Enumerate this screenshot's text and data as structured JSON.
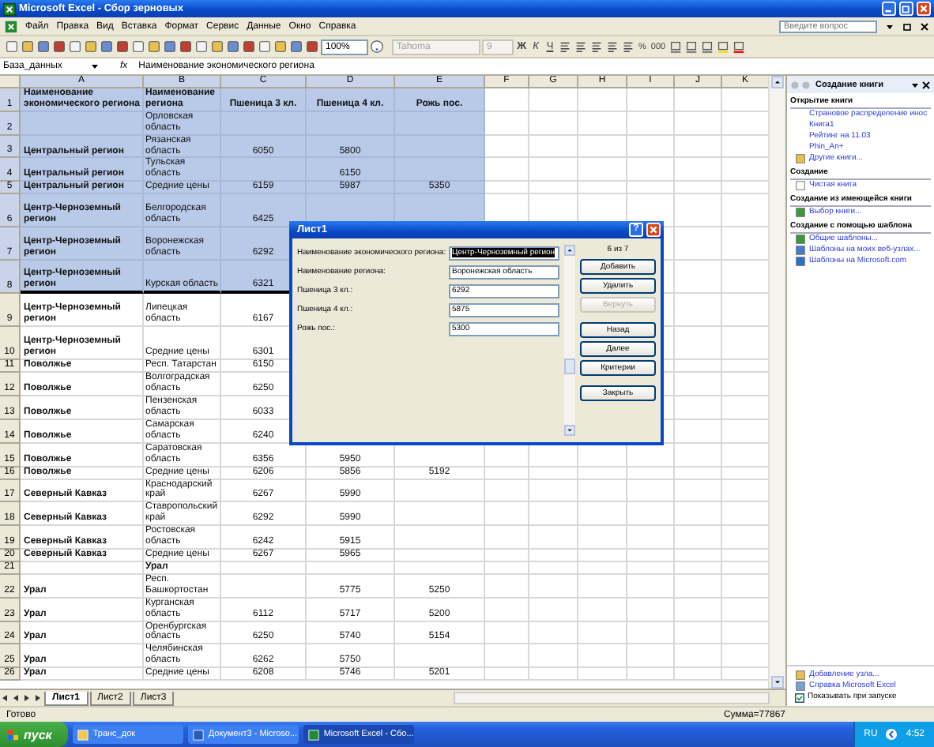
{
  "window": {
    "title": "Microsoft Excel - Сбор зерновых"
  },
  "menu": [
    {
      "label": "Файл"
    },
    {
      "label": "Правка"
    },
    {
      "label": "Вид"
    },
    {
      "label": "Вставка"
    },
    {
      "label": "Формат"
    },
    {
      "label": "Сервис"
    },
    {
      "label": "Данные"
    },
    {
      "label": "Окно"
    },
    {
      "label": "Справка"
    }
  ],
  "help_box": {
    "placeholder": "Введите вопрос"
  },
  "toolbar": {
    "zoom": "100%",
    "font": {
      "value": "Tahoma",
      "disabled": true
    },
    "size": {
      "value": "9",
      "disabled": true
    },
    "format_buttons": [
      "Ж",
      "К",
      "Ч"
    ],
    "number_buttons": [
      "%",
      "000"
    ]
  },
  "formula_bar": {
    "name_box": "База_данных",
    "fx": "fx",
    "content": "Наименование экономического региона"
  },
  "columns": [
    {
      "label": "A",
      "selected": true
    },
    {
      "label": "B",
      "selected": true
    },
    {
      "label": "C",
      "selected": true
    },
    {
      "label": "D",
      "selected": true
    },
    {
      "label": "E",
      "selected": true
    },
    {
      "label": "F",
      "selected": false
    },
    {
      "label": "G",
      "selected": false
    },
    {
      "label": "H",
      "selected": false
    },
    {
      "label": "I",
      "selected": false
    },
    {
      "label": "J",
      "selected": false
    },
    {
      "label": "K",
      "selected": false
    }
  ],
  "rows": [
    {
      "n": "1",
      "kind": "header",
      "selected": true,
      "a": "Наименование экономического региона",
      "b": "Наименование региона",
      "c": "Пшеница 3 кл.",
      "d": "Пшеница 4 кл.",
      "e": "Рожь пос."
    },
    {
      "n": "2",
      "kind": "data",
      "selected": true,
      "b": "Орловская область"
    },
    {
      "n": "3",
      "kind": "data",
      "selected": true,
      "a": "Центральный регион",
      "b": "Рязанская область",
      "c": "6050",
      "d": "5800"
    },
    {
      "n": "4",
      "kind": "data",
      "selected": true,
      "a": "Центральный регион",
      "b": "Тульская область",
      "d": "6150"
    },
    {
      "n": "5",
      "kind": "data",
      "selected": true,
      "a": "Центральный регион",
      "b": "Средние цены",
      "c": "6159",
      "d": "5987",
      "e": "5350"
    },
    {
      "n": "6",
      "kind": "data",
      "selected": true,
      "tall": true,
      "a": "Центр-Черноземный регион",
      "b": "Белгородская область",
      "c": "6425"
    },
    {
      "n": "7",
      "kind": "data",
      "selected": true,
      "tall": true,
      "a": "Центр-Черноземный регион",
      "b": "Воронежская область",
      "c": "6292"
    },
    {
      "n": "8",
      "kind": "data",
      "selected": true,
      "tall": true,
      "a": "Центр-Черноземный регион",
      "b": "Курская область",
      "c": "6321"
    },
    {
      "n": "9",
      "kind": "data",
      "selected": false,
      "tall": true,
      "a": "Центр-Черноземный регион",
      "b": "Липецкая область",
      "c": "6167"
    },
    {
      "n": "10",
      "kind": "data",
      "selected": false,
      "tall": true,
      "a": "Центр-Черноземный регион",
      "b": "Средние цены",
      "c": "6301"
    },
    {
      "n": "11",
      "kind": "data",
      "selected": false,
      "a": "Поволжье",
      "b": "Респ. Татарстан",
      "c": "6150"
    },
    {
      "n": "12",
      "kind": "data",
      "selected": false,
      "a": "Поволжье",
      "b": "Волгоградская область",
      "c": "6250"
    },
    {
      "n": "13",
      "kind": "data",
      "selected": false,
      "a": "Поволжье",
      "b": "Пензенская область",
      "c": "6033"
    },
    {
      "n": "14",
      "kind": "data",
      "selected": false,
      "a": "Поволжье",
      "b": "Самарская область",
      "c": "6240"
    },
    {
      "n": "15",
      "kind": "data",
      "selected": false,
      "a": "Поволжье",
      "b": "Саратовская область",
      "c": "6356",
      "d": "5950"
    },
    {
      "n": "16",
      "kind": "data",
      "selected": false,
      "a": "Поволжье",
      "b": "Средние цены",
      "c": "6206",
      "d": "5856",
      "e": "5192"
    },
    {
      "n": "17",
      "kind": "data",
      "selected": false,
      "a": "Северный Кавказ",
      "b": "Краснодарский край",
      "c": "6267",
      "d": "5990"
    },
    {
      "n": "18",
      "kind": "data",
      "selected": false,
      "a": "Северный Кавказ",
      "b": "Ставропольский край",
      "c": "6292",
      "d": "5990"
    },
    {
      "n": "19",
      "kind": "data",
      "selected": false,
      "a": "Северный Кавказ",
      "b": "Ростовская область",
      "c": "6242",
      "d": "5915"
    },
    {
      "n": "20",
      "kind": "data",
      "selected": false,
      "a": "Северный Кавказ",
      "b": "Средние цены",
      "c": "6267",
      "d": "5965"
    },
    {
      "n": "21",
      "kind": "group",
      "selected": false,
      "b": "Урал"
    },
    {
      "n": "22",
      "kind": "data",
      "selected": false,
      "a": "Урал",
      "b": "Респ. Башкортостан",
      "d": "5775",
      "e": "5250"
    },
    {
      "n": "23",
      "kind": "data",
      "selected": false,
      "a": "Урал",
      "b": "Курганская область",
      "c": "6112",
      "d": "5717",
      "e": "5200"
    },
    {
      "n": "24",
      "kind": "data",
      "selected": false,
      "a": "Урал",
      "b": "Оренбургская область",
      "c": "6250",
      "d": "5740",
      "e": "5154"
    },
    {
      "n": "25",
      "kind": "data",
      "selected": false,
      "a": "Урал",
      "b": "Челябинская область",
      "c": "6262",
      "d": "5750"
    },
    {
      "n": "26",
      "kind": "data",
      "selected": false,
      "a": "Урал",
      "b": "Средние цены",
      "c": "6208",
      "d": "5746",
      "e": "5201"
    }
  ],
  "sheet_tabs": [
    {
      "label": "Лист1",
      "selected": true
    },
    {
      "label": "Лист2",
      "selected": false
    },
    {
      "label": "Лист3",
      "selected": false
    }
  ],
  "dialog": {
    "title": "Лист1",
    "help": "?",
    "counter": "6 из 7",
    "fields": [
      {
        "label": "Наименование экономического региона:",
        "value": "Центр-Черноземный регион",
        "selected": true
      },
      {
        "label": "Наименование региона:",
        "value": "Воронежская область",
        "selected": false
      },
      {
        "label": "Пшеница 3 кл.:",
        "value": "6292",
        "selected": false
      },
      {
        "label": "Пшеница 4 кл.:",
        "value": "5875",
        "selected": false
      },
      {
        "label": "Рожь пос.:",
        "value": "5300",
        "selected": false
      }
    ],
    "buttons": [
      {
        "label": "Добавить",
        "disabled": false
      },
      {
        "label": "Удалить",
        "disabled": false
      },
      {
        "label": "Вернуть",
        "disabled": true
      },
      {
        "label": "Назад",
        "disabled": false
      },
      {
        "label": "Далее",
        "disabled": false
      },
      {
        "label": "Критерии",
        "disabled": false
      },
      {
        "label": "Закрыть",
        "disabled": false
      }
    ]
  },
  "task_pane": {
    "title": "Создание книги",
    "sections": [
      {
        "heading": "Открытие книги",
        "items": [
          {
            "label": "Страновое распределение инос"
          },
          {
            "label": "Книга1"
          },
          {
            "label": "Рейтинг на 11.03"
          },
          {
            "label": "Phin_An+"
          },
          {
            "label": "Другие книги..."
          }
        ]
      },
      {
        "heading": "Создание",
        "items": [
          {
            "label": "Чистая книга"
          }
        ]
      },
      {
        "heading": "Создание из имеющейся книги",
        "items": [
          {
            "label": "Выбор книги..."
          }
        ]
      },
      {
        "heading": "Создание с помощью шаблона",
        "items": [
          {
            "label": "Общие шаблоны..."
          },
          {
            "label": "Шаблоны на моих веб-узлах..."
          },
          {
            "label": "Шаблоны на Microsoft.com"
          }
        ]
      }
    ],
    "footer": [
      {
        "label": "Добавление узла..."
      },
      {
        "label": "Справка Microsoft Excel"
      }
    ],
    "startup": {
      "label": "Показывать при запуске",
      "checked": true
    }
  },
  "status_bar": {
    "left": "Готово",
    "sum": "Сумма=77867"
  },
  "taskbar": {
    "start": "пуск",
    "items": [
      {
        "label": "Транс_док",
        "selected": false
      },
      {
        "label": "Документ3 - Microso...",
        "selected": false
      },
      {
        "label": "Microsoft Excel - Сбо...",
        "selected": true
      }
    ],
    "lang": "RU",
    "time": "4:52"
  }
}
